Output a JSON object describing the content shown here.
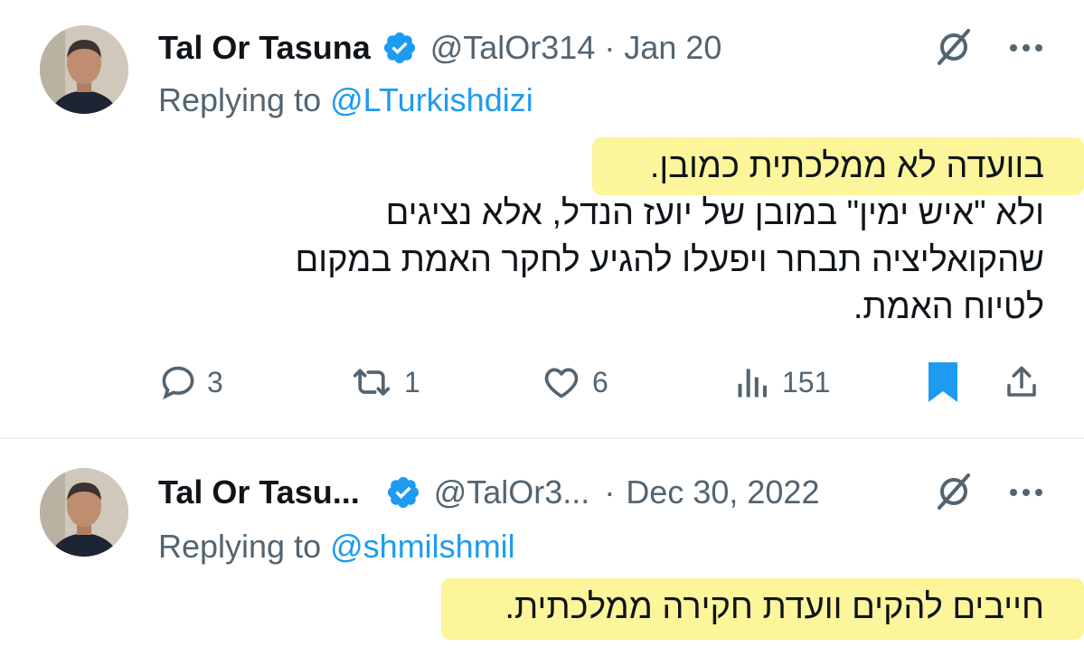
{
  "tweets": [
    {
      "author_name": "Tal Or Tasuna",
      "handle": "@TalOr314",
      "separator": "·",
      "date": "Jan 20",
      "replying_prefix": "Replying to",
      "replying_to": "@LTurkishdizi",
      "lines": [
        "בוועדה לא ממלכתית כמובן.",
        "ולא \"איש ימין\" במובן של יועז הנדל, אלא נציגים",
        "שהקואליציה תבחר ויפעלו להגיע לחקר האמת במקום",
        "לטיוח האמת."
      ],
      "stats": {
        "replies": "3",
        "reposts": "1",
        "likes": "6",
        "views": "151"
      }
    },
    {
      "author_name": "Tal Or Tasu...",
      "handle": "@TalOr3...",
      "separator": "·",
      "date": "Dec 30, 2022",
      "replying_prefix": "Replying to",
      "replying_to": "@shmilshmil",
      "lines": [
        "חייבים להקים וועדת חקירה ממלכתית."
      ]
    }
  ],
  "colors": {
    "accent": "#1d9bf0",
    "muted": "#536471",
    "text": "#0f1419",
    "highlight": "#fdf59a"
  },
  "icons": [
    "verified-badge-icon",
    "grok-icon",
    "more-icon",
    "reply-icon",
    "repost-icon",
    "like-icon",
    "views-icon",
    "bookmark-icon",
    "share-icon"
  ]
}
